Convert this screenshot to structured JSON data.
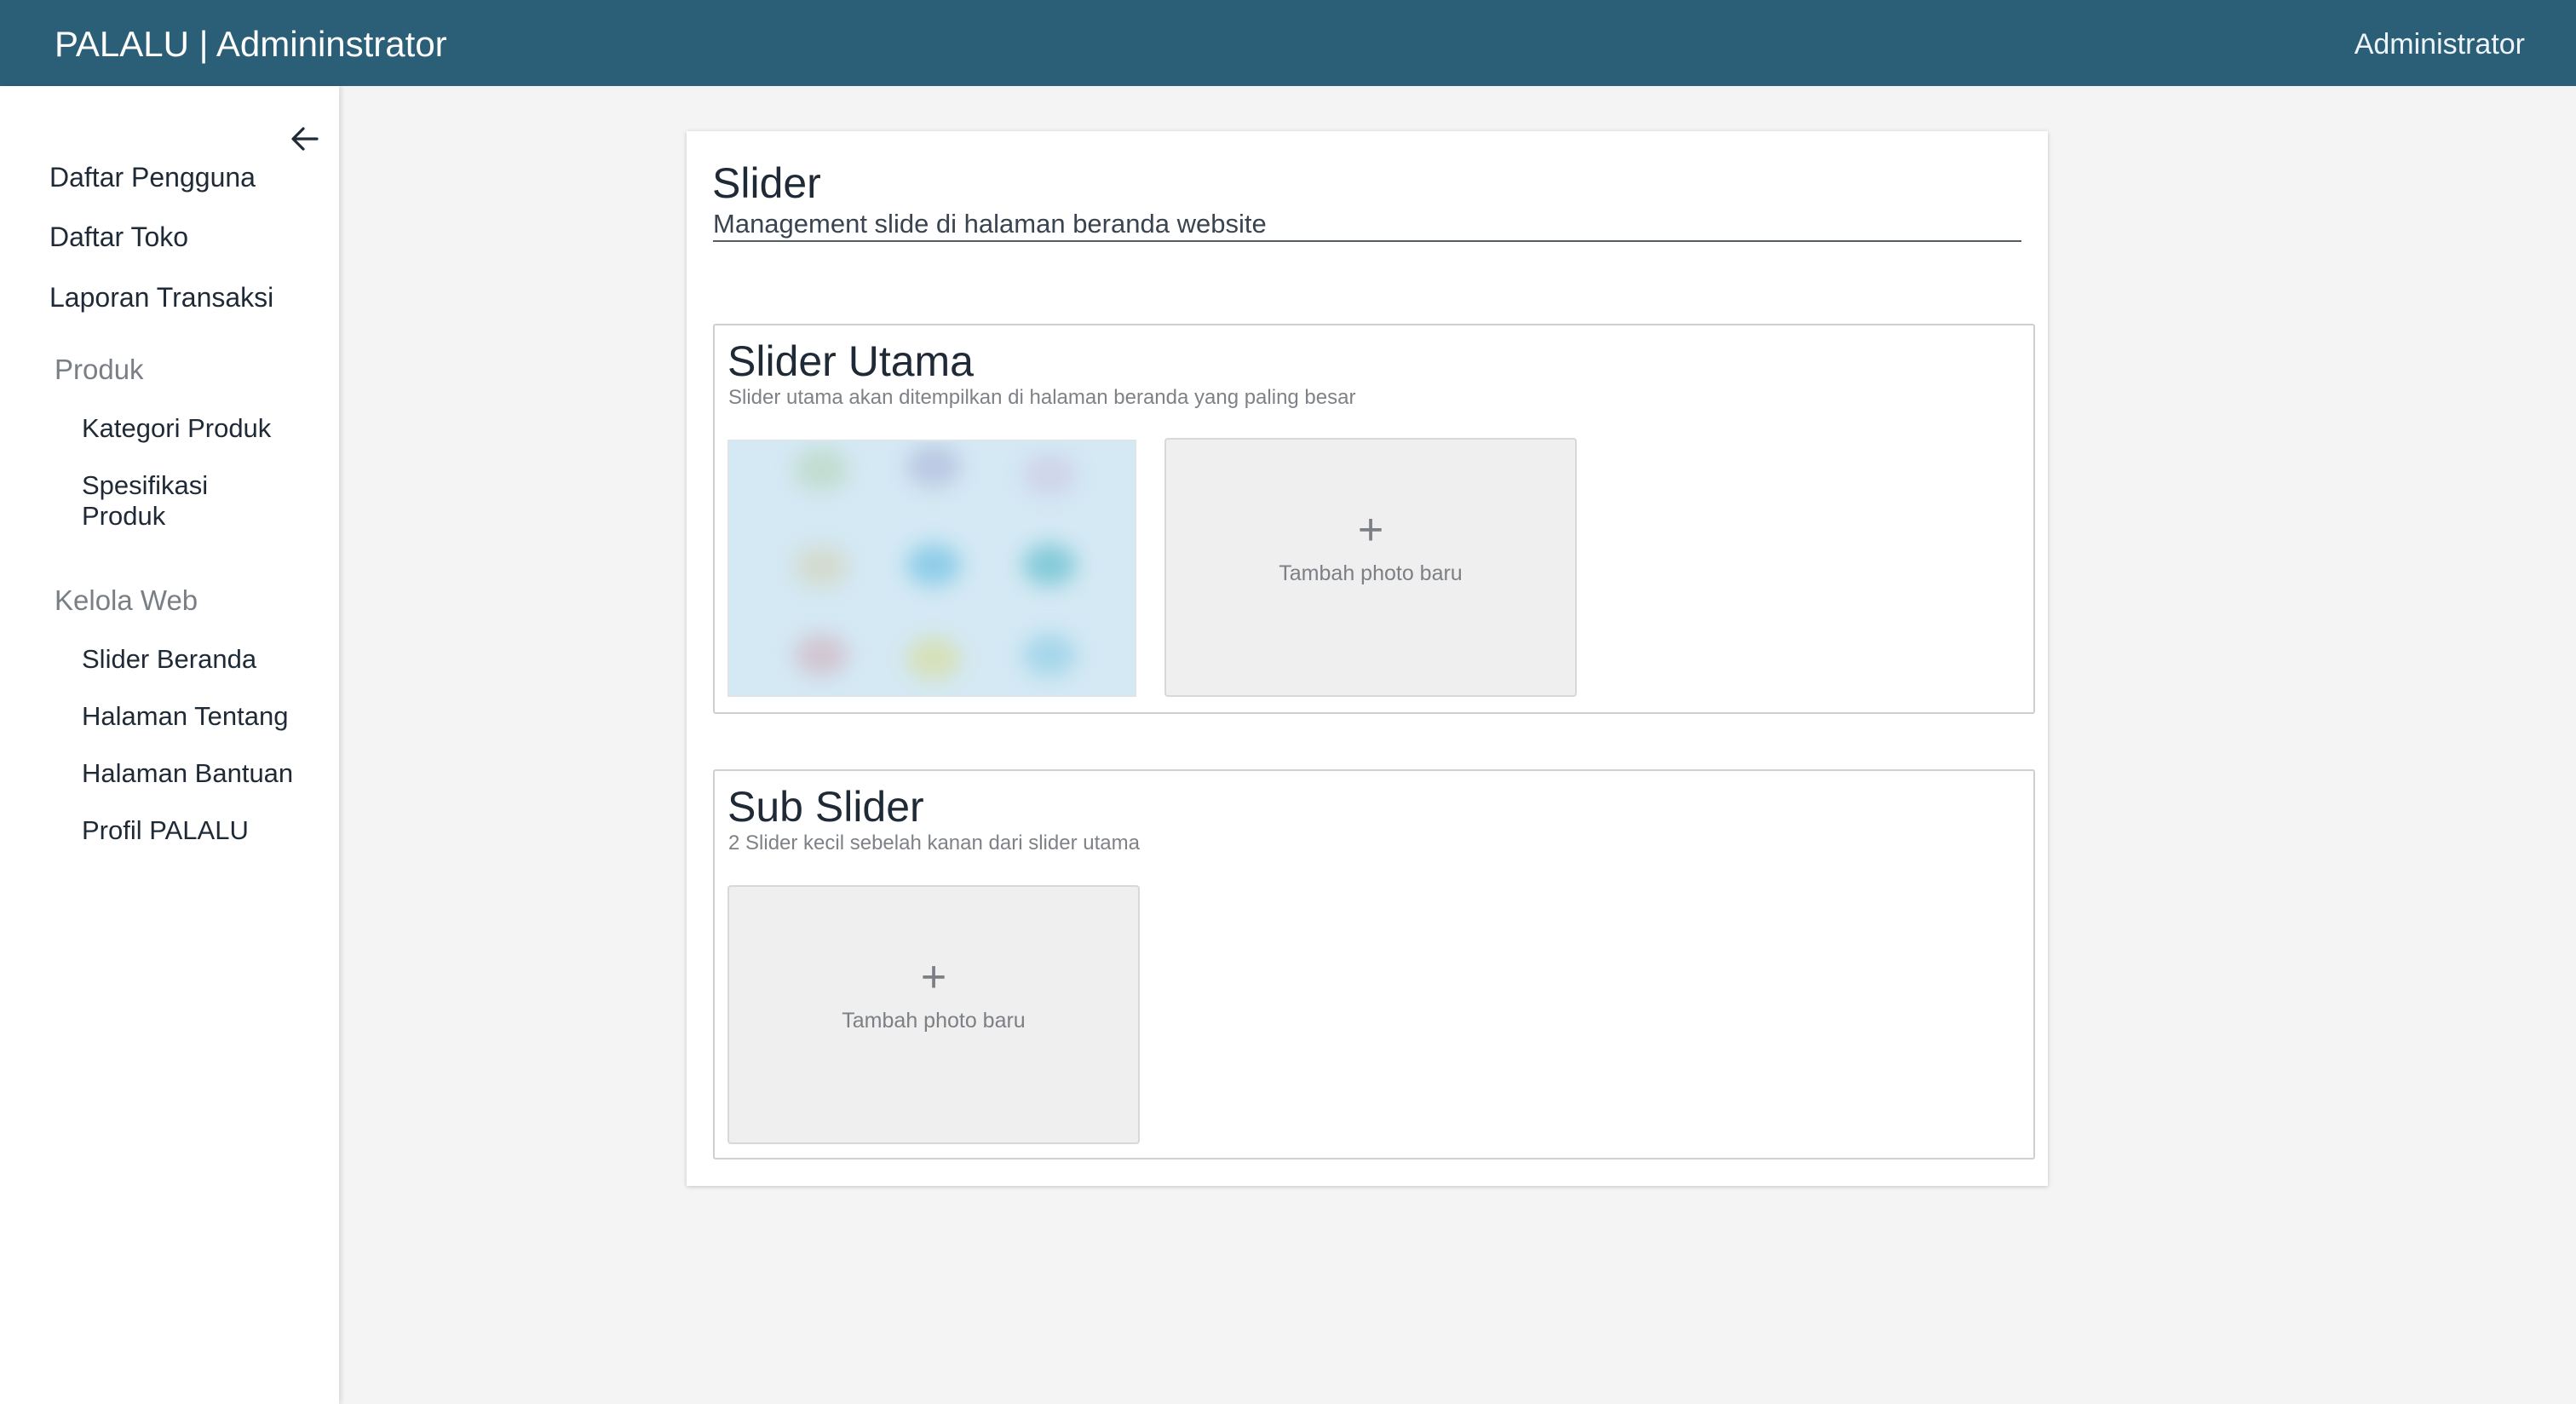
{
  "header": {
    "app_title": "PALALU | Admininstrator",
    "user_name": "Administrator"
  },
  "sidebar": {
    "back_icon": "arrow-left-icon",
    "items": {
      "users": "Daftar Pengguna",
      "stores": "Daftar Toko",
      "transactions": "Laporan Transaksi"
    },
    "groups": {
      "product": {
        "label": "Produk",
        "items": {
          "categories": "Kategori Produk",
          "specifications": "Spesifikasi Produk"
        }
      },
      "web": {
        "label": "Kelola Web",
        "items": {
          "slider": "Slider Beranda",
          "about": "Halaman Tentang",
          "help": "Halaman Bantuan",
          "profile": "Profil PALALU"
        }
      }
    }
  },
  "page": {
    "title": "Slider",
    "subtitle": "Management slide di halaman beranda website"
  },
  "main_slider": {
    "title": "Slider Utama",
    "description": "Slider utama akan ditempilkan di halaman beranda yang paling besar",
    "add_label": "Tambah photo baru"
  },
  "sub_slider": {
    "title": "Sub Slider",
    "description": "2 Slider kecil sebelah kanan dari slider utama",
    "add_label": "Tambah photo baru"
  },
  "colors": {
    "header_bg": "#2b5f78",
    "page_bg": "#f4f4f4",
    "text": "#1f2a36"
  }
}
